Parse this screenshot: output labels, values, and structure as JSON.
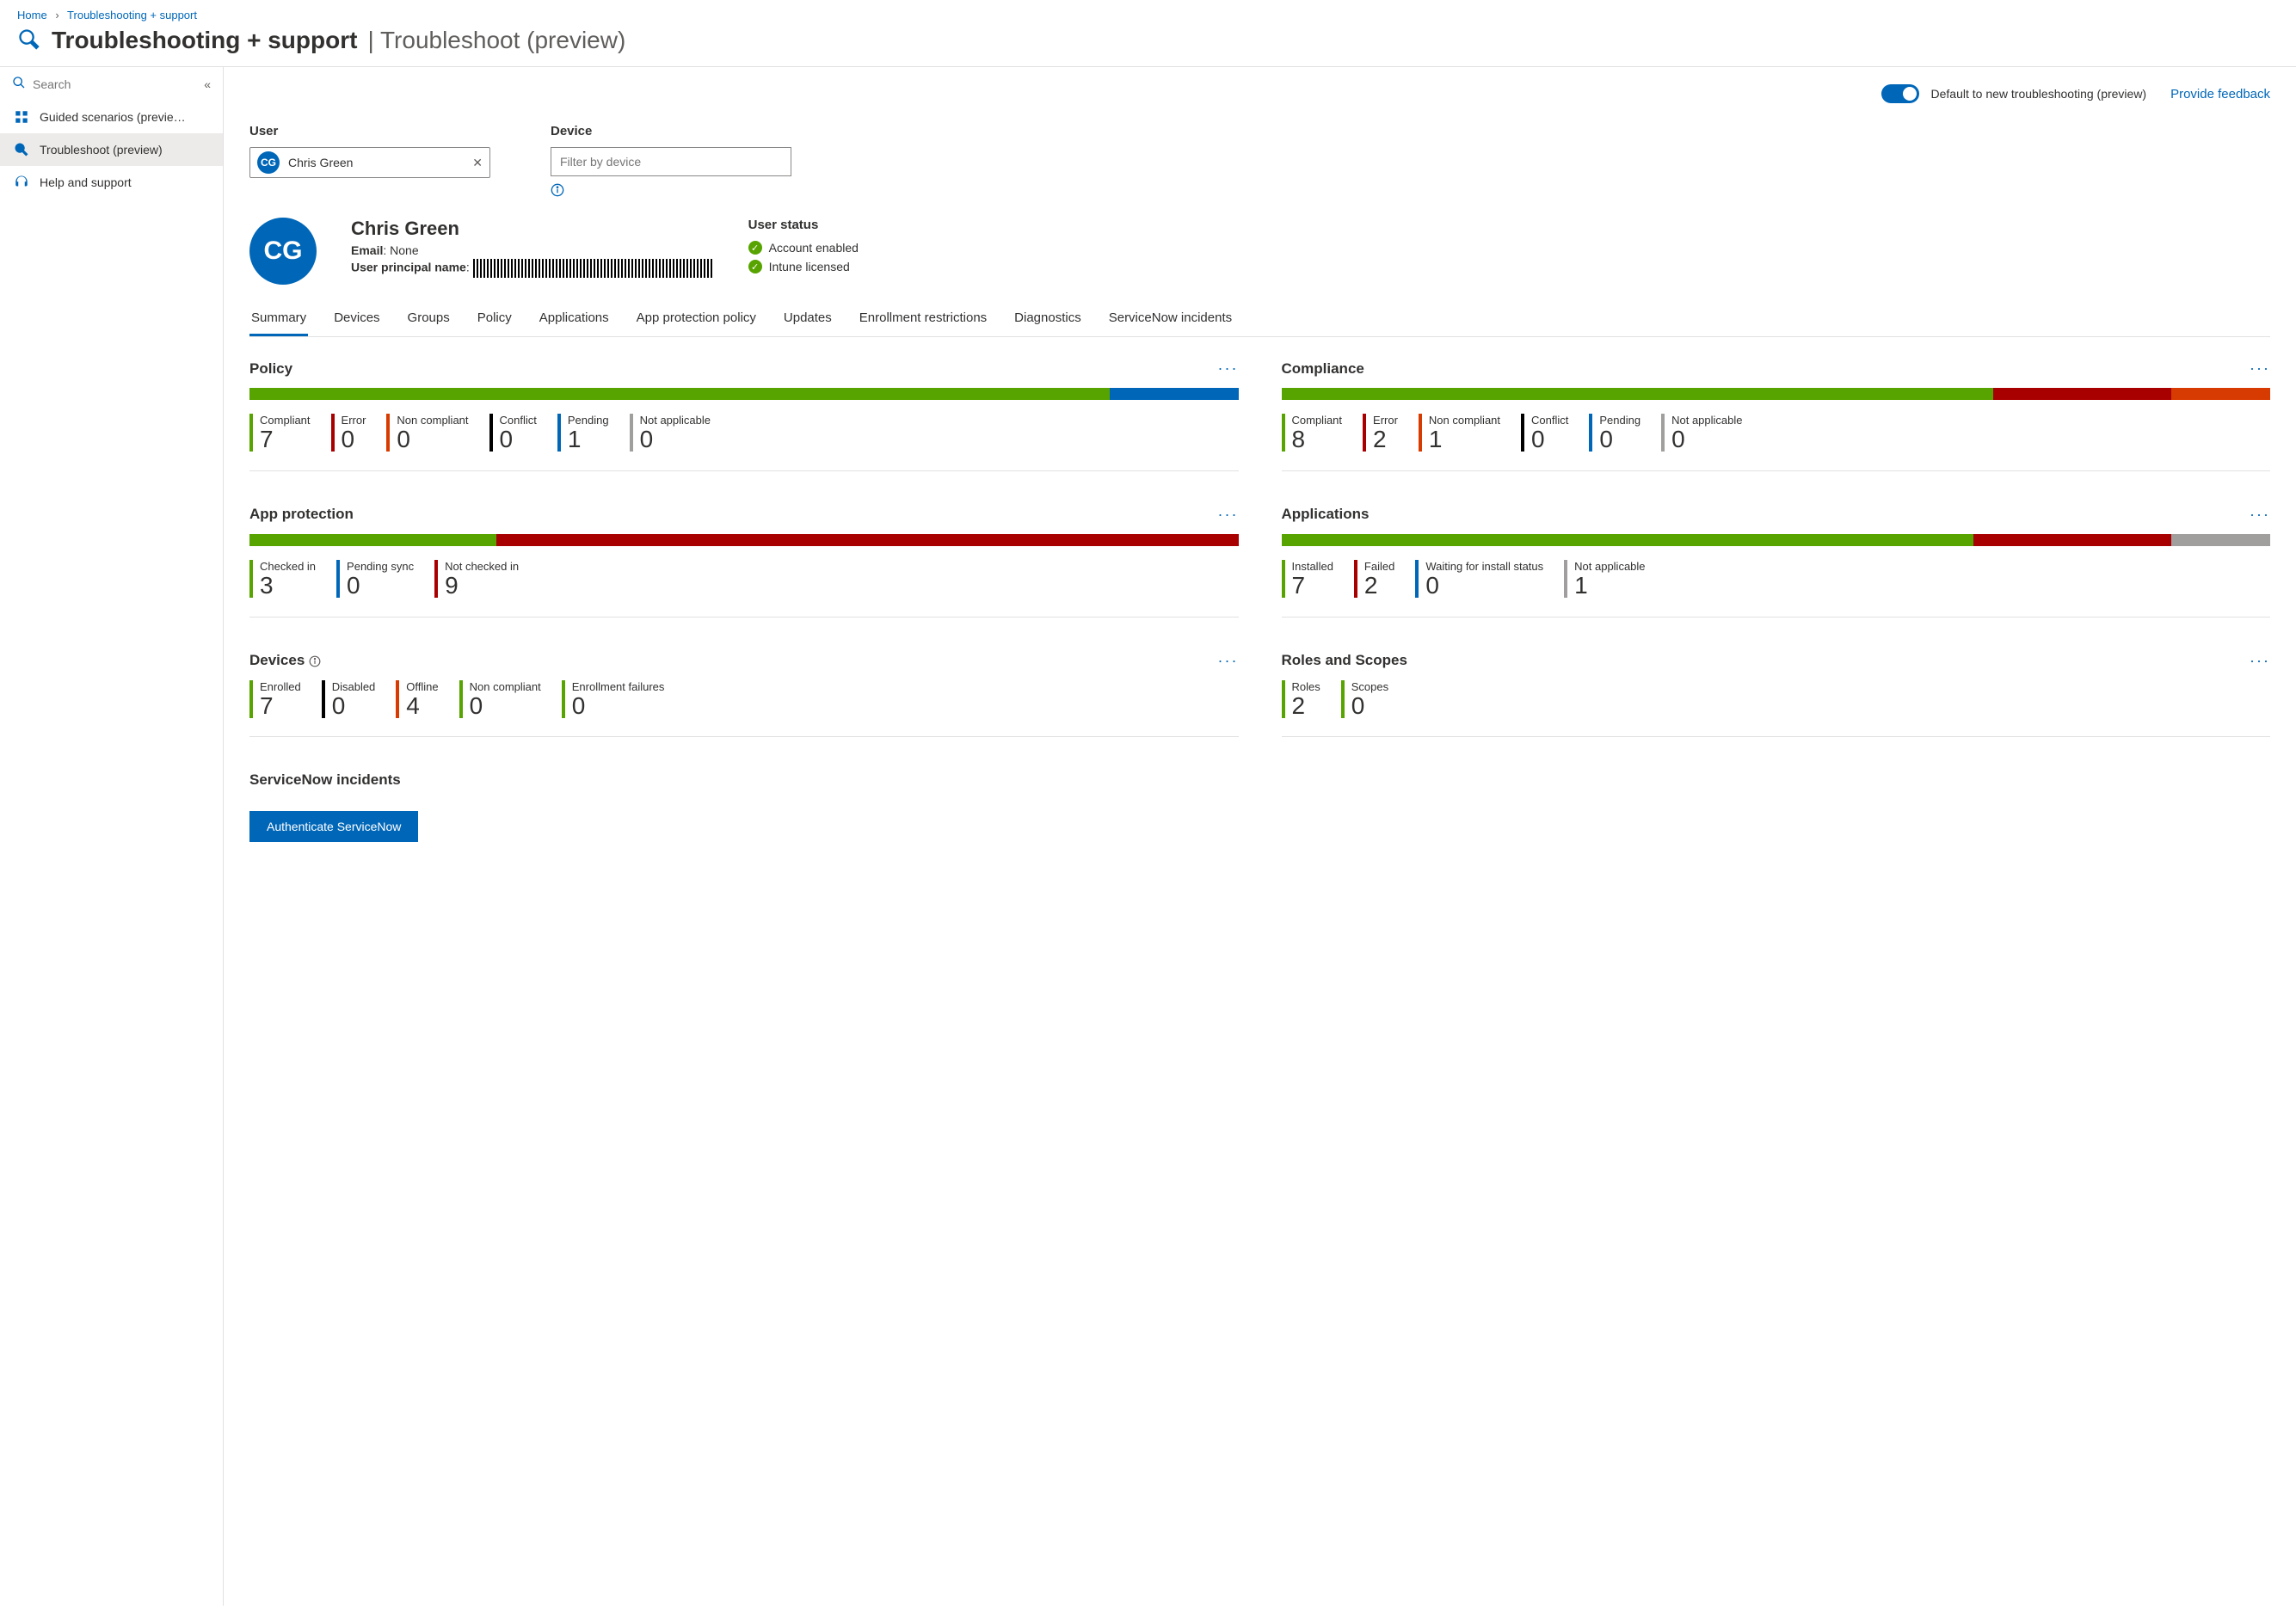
{
  "breadcrumb": {
    "home": "Home",
    "section": "Troubleshooting + support"
  },
  "page": {
    "title": "Troubleshooting + support",
    "subtitle": "Troubleshoot (preview)"
  },
  "sidebar": {
    "search_placeholder": "Search",
    "items": [
      {
        "label": "Guided scenarios (previe…"
      },
      {
        "label": "Troubleshoot (preview)"
      },
      {
        "label": "Help and support"
      }
    ]
  },
  "top_actions": {
    "toggle_label": "Default to new troubleshooting (preview)",
    "feedback": "Provide feedback"
  },
  "filters": {
    "user_label": "User",
    "user_chip": {
      "initials": "CG",
      "name": "Chris Green"
    },
    "device_label": "Device",
    "device_placeholder": "Filter by device"
  },
  "profile": {
    "initials": "CG",
    "name": "Chris Green",
    "email_label": "Email",
    "email_value": "None",
    "upn_label": "User principal name"
  },
  "user_status": {
    "title": "User status",
    "items": [
      "Account enabled",
      "Intune licensed"
    ]
  },
  "tabs": [
    "Summary",
    "Devices",
    "Groups",
    "Policy",
    "Applications",
    "App protection policy",
    "Updates",
    "Enrollment restrictions",
    "Diagnostics",
    "ServiceNow incidents"
  ],
  "cards": {
    "policy": {
      "title": "Policy",
      "bar": [
        {
          "color": "c-green",
          "flex": 87
        },
        {
          "color": "c-blue",
          "flex": 13
        }
      ],
      "stats": [
        {
          "label": "Compliant",
          "value": "7",
          "color": "c-green"
        },
        {
          "label": "Error",
          "value": "0",
          "color": "c-red"
        },
        {
          "label": "Non compliant",
          "value": "0",
          "color": "c-orange"
        },
        {
          "label": "Conflict",
          "value": "0",
          "color": "c-black"
        },
        {
          "label": "Pending",
          "value": "1",
          "color": "c-blue"
        },
        {
          "label": "Not applicable",
          "value": "0",
          "color": "c-grey"
        }
      ]
    },
    "compliance": {
      "title": "Compliance",
      "bar": [
        {
          "color": "c-green",
          "flex": 72
        },
        {
          "color": "c-red",
          "flex": 18
        },
        {
          "color": "c-orange",
          "flex": 10
        }
      ],
      "stats": [
        {
          "label": "Compliant",
          "value": "8",
          "color": "c-green"
        },
        {
          "label": "Error",
          "value": "2",
          "color": "c-red"
        },
        {
          "label": "Non compliant",
          "value": "1",
          "color": "c-orange"
        },
        {
          "label": "Conflict",
          "value": "0",
          "color": "c-black"
        },
        {
          "label": "Pending",
          "value": "0",
          "color": "c-blue"
        },
        {
          "label": "Not applicable",
          "value": "0",
          "color": "c-grey"
        }
      ]
    },
    "app_protection": {
      "title": "App protection",
      "bar": [
        {
          "color": "c-green",
          "flex": 25
        },
        {
          "color": "c-red",
          "flex": 75
        }
      ],
      "stats": [
        {
          "label": "Checked in",
          "value": "3",
          "color": "c-green"
        },
        {
          "label": "Pending sync",
          "value": "0",
          "color": "c-blue"
        },
        {
          "label": "Not checked in",
          "value": "9",
          "color": "c-red"
        }
      ]
    },
    "applications": {
      "title": "Applications",
      "bar": [
        {
          "color": "c-green",
          "flex": 70
        },
        {
          "color": "c-red",
          "flex": 20
        },
        {
          "color": "c-grey",
          "flex": 10
        }
      ],
      "stats": [
        {
          "label": "Installed",
          "value": "7",
          "color": "c-green"
        },
        {
          "label": "Failed",
          "value": "2",
          "color": "c-red"
        },
        {
          "label": "Waiting for install status",
          "value": "0",
          "color": "c-blue"
        },
        {
          "label": "Not applicable",
          "value": "1",
          "color": "c-grey"
        }
      ]
    },
    "devices": {
      "title": "Devices",
      "stats": [
        {
          "label": "Enrolled",
          "value": "7",
          "color": "c-green"
        },
        {
          "label": "Disabled",
          "value": "0",
          "color": "c-black"
        },
        {
          "label": "Offline",
          "value": "4",
          "color": "c-orange"
        },
        {
          "label": "Non compliant",
          "value": "0",
          "color": "c-green"
        },
        {
          "label": "Enrollment failures",
          "value": "0",
          "color": "c-green"
        }
      ]
    },
    "roles": {
      "title": "Roles and Scopes",
      "stats": [
        {
          "label": "Roles",
          "value": "2",
          "color": "c-green"
        },
        {
          "label": "Scopes",
          "value": "0",
          "color": "c-green"
        }
      ]
    },
    "snow": {
      "title": "ServiceNow incidents",
      "button": "Authenticate ServiceNow"
    }
  }
}
